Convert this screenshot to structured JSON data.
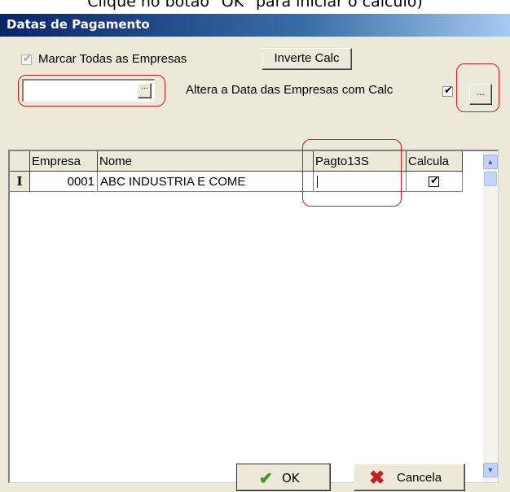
{
  "instruction_text": "Clique no botão \"OK\" para iniciar o cálculo)",
  "window": {
    "title": "Datas de Pagamento"
  },
  "controls": {
    "select_all_label": "Marcar Todas as Empresas",
    "select_all_checked": true,
    "invert_button": "Inverte Calc",
    "date_value": "",
    "date_picker_button": "...",
    "change_date_label": "Altera a Data das Empresas com Calc",
    "change_date_checked": true,
    "ellipsis_button": "..."
  },
  "grid": {
    "columns": [
      "Empresa",
      "Nome",
      "Pagto13S",
      "Calcula"
    ],
    "rows": [
      {
        "indicator": "I",
        "empresa": "0001",
        "nome": "ABC INDUSTRIA E COME",
        "pagto13s": "",
        "calcula": true
      }
    ]
  },
  "footer": {
    "ok_button": "OK",
    "cancel_button": "Cancela"
  },
  "colors": {
    "title_bar": "#0a246a",
    "dialog_bg": "#ece9d8",
    "annotation_red": "#d02020",
    "ok_check": "#3a9a1a",
    "cancel_x": "#c8201a"
  },
  "icons": {
    "check": "check-icon",
    "cancel": "x-icon",
    "scroll_up": "chevron-up-icon",
    "scroll_down": "chevron-down-icon"
  }
}
